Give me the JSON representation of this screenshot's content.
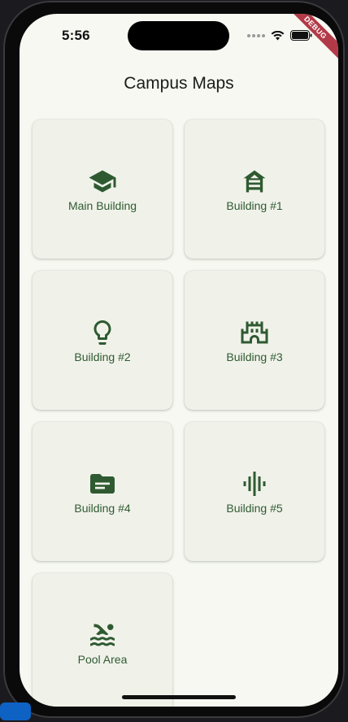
{
  "status_bar": {
    "time": "5:56"
  },
  "debug_banner": "DEBUG",
  "app_bar": {
    "title": "Campus Maps"
  },
  "accent_color": "#2f5a31",
  "cards": [
    {
      "label": "Main Building",
      "icon": "school-icon"
    },
    {
      "label": "Building #1",
      "icon": "house-icon"
    },
    {
      "label": "Building #2",
      "icon": "lightbulb-icon"
    },
    {
      "label": "Building #3",
      "icon": "castle-icon"
    },
    {
      "label": "Building #4",
      "icon": "folder-icon"
    },
    {
      "label": "Building #5",
      "icon": "graphic-eq-icon"
    },
    {
      "label": "Pool Area",
      "icon": "pool-icon"
    }
  ]
}
